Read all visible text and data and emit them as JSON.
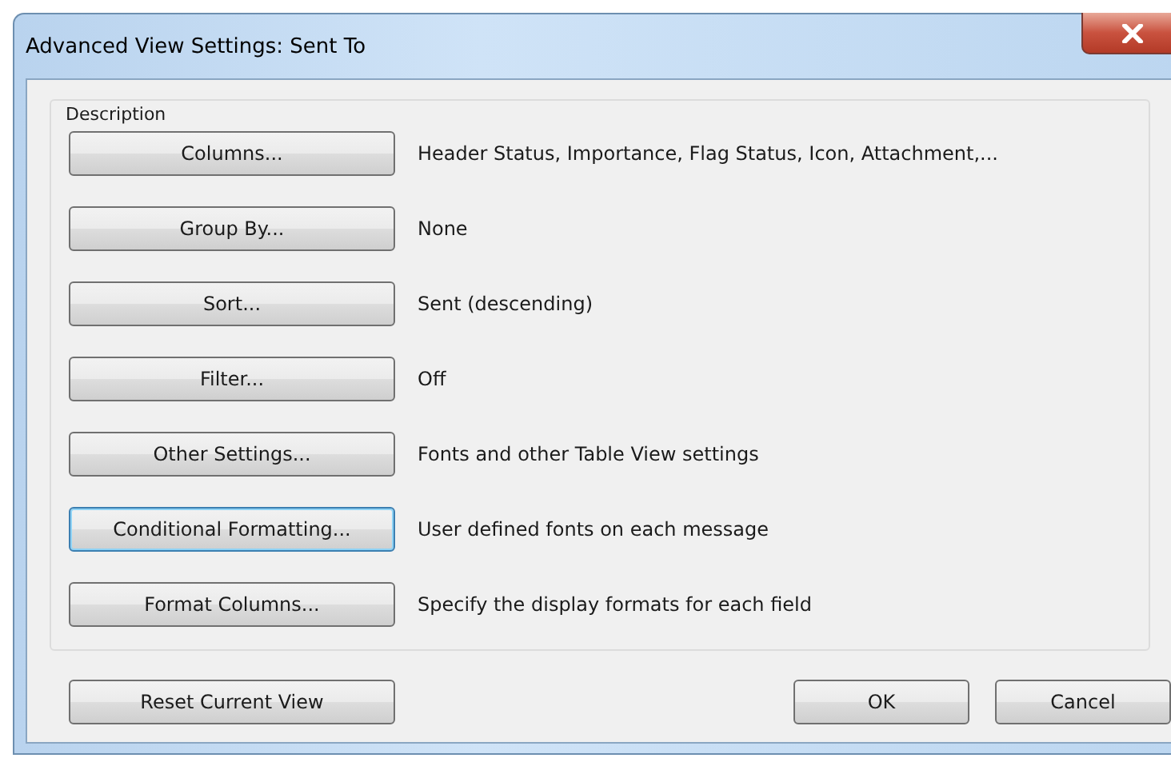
{
  "window": {
    "title": "Advanced View Settings: Sent To"
  },
  "group": {
    "label": "Description"
  },
  "settings": [
    {
      "button": "Columns...",
      "description": "Header Status, Importance, Flag Status, Icon, Attachment,...",
      "focused": false
    },
    {
      "button": "Group By...",
      "description": "None",
      "focused": false
    },
    {
      "button": "Sort...",
      "description": "Sent (descending)",
      "focused": false
    },
    {
      "button": "Filter...",
      "description": "Off",
      "focused": false
    },
    {
      "button": "Other Settings...",
      "description": "Fonts and other Table View settings",
      "focused": false
    },
    {
      "button": "Conditional Formatting...",
      "description": "User defined fonts on each message",
      "focused": true
    },
    {
      "button": "Format Columns...",
      "description": "Specify the display formats for each field",
      "focused": false
    }
  ],
  "footer": {
    "reset": "Reset Current View",
    "ok": "OK",
    "cancel": "Cancel"
  }
}
